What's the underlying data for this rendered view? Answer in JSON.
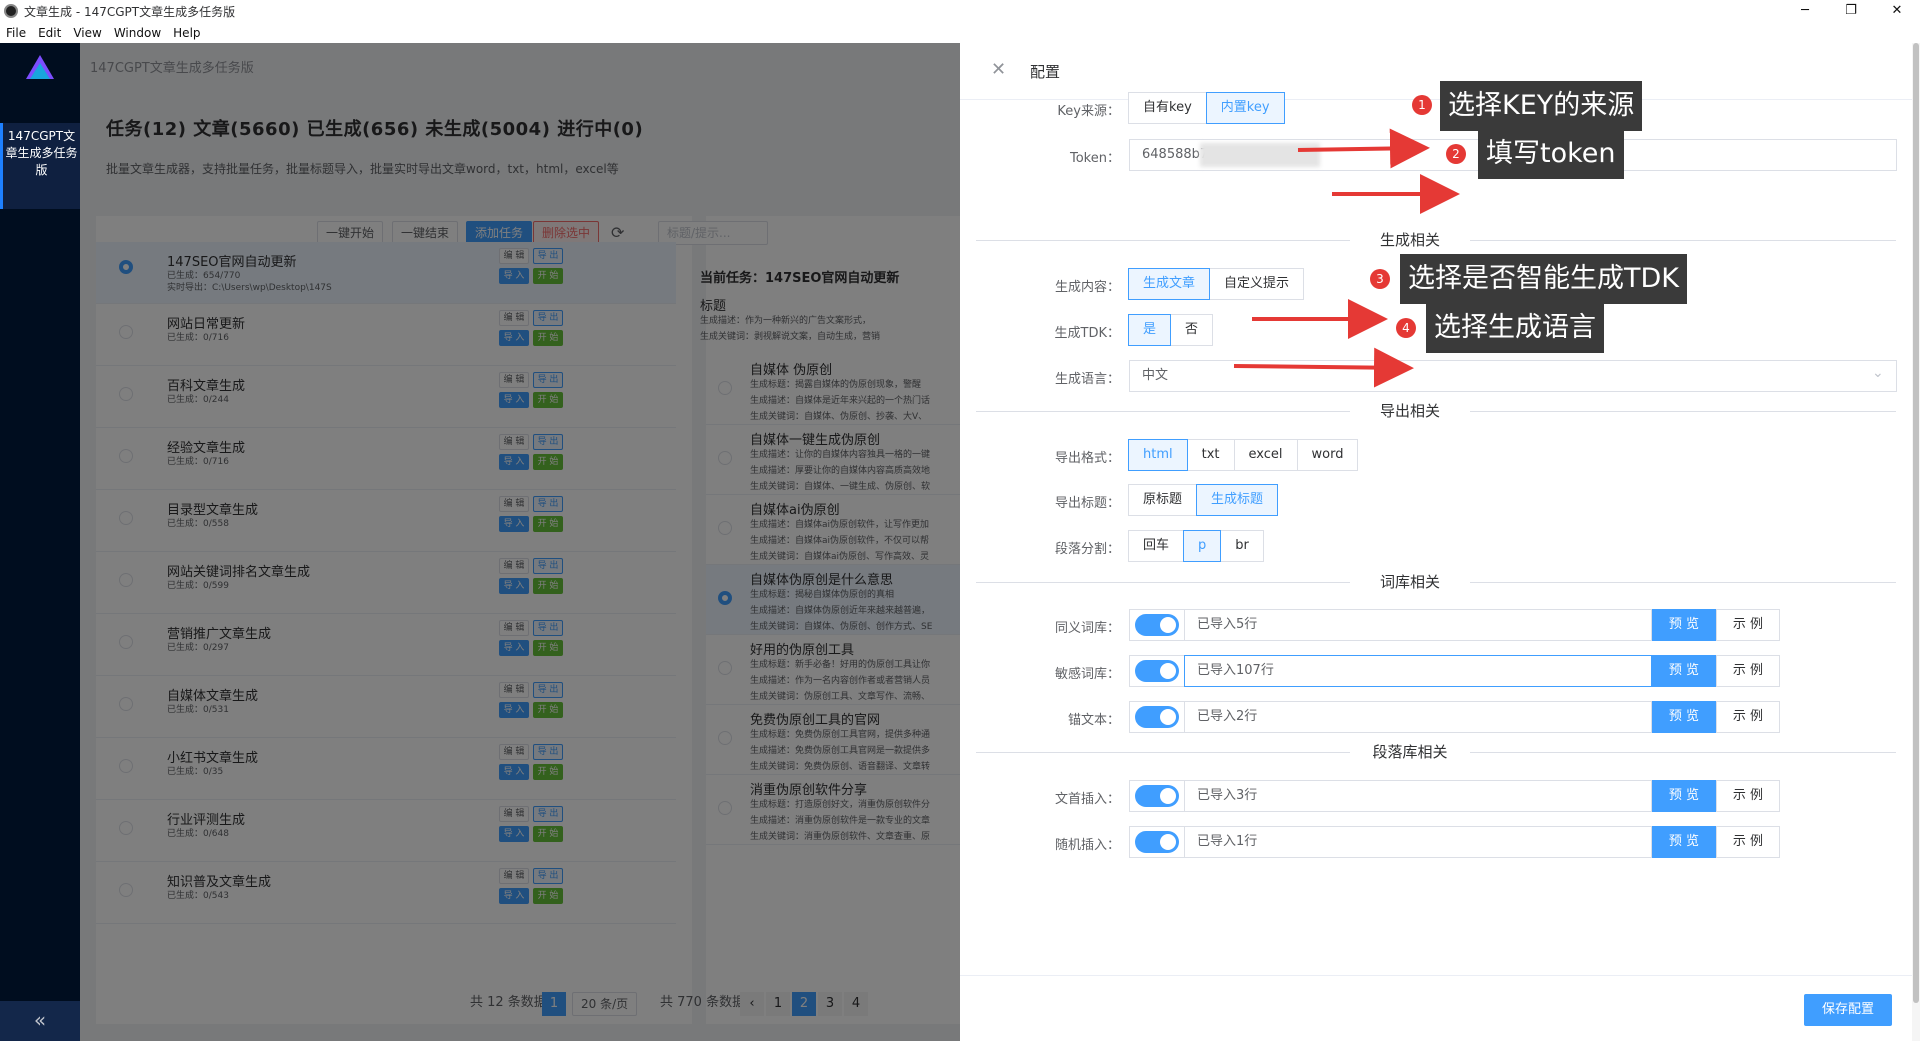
{
  "window": {
    "title": "文章生成 - 147CGPT文章生成多任务版",
    "controls": [
      "─",
      "❐",
      "✕"
    ]
  },
  "menu": [
    "File",
    "Edit",
    "View",
    "Window",
    "Help"
  ],
  "sidebar": {
    "item_label": "147CGPT文章生成多任务版",
    "collapse": "«"
  },
  "breadcrumb": "147CGPT文章生成多任务版",
  "header": {
    "title": "任务(12) 文章(5660) 已生成(656) 未生成(5004) 进行中(0)",
    "desc": "批量文章生成器，支持批量任务，批量标题导入，批量实时导出文章word，txt，html，excel等"
  },
  "toolbar": {
    "start_all": "一键开始",
    "end_all": "一键结束",
    "add_task": "添加任务",
    "delete_selected": "删除选中",
    "search_placeholder": "标题/提示..."
  },
  "task_table": {
    "col_task": "任务",
    "col_op": "操作",
    "btn_edit": "编 辑",
    "btn_export": "导 出",
    "btn_import": "导 入",
    "btn_start": "开 始",
    "rows": [
      {
        "name": "147SEO官网自动更新",
        "sub": "已生成：654/770",
        "extra": "实时导出：C:\\Users\\wp\\Desktop\\147S",
        "selected": true
      },
      {
        "name": "网站日常更新",
        "sub": "已生成：0/716",
        "selected": false
      },
      {
        "name": "百科文章生成",
        "sub": "已生成：0/244",
        "selected": false
      },
      {
        "name": "经验文章生成",
        "sub": "已生成：0/716",
        "selected": false
      },
      {
        "name": "目录型文章生成",
        "sub": "已生成：0/558",
        "selected": false
      },
      {
        "name": "网站关键词排名文章生成",
        "sub": "已生成：0/599",
        "selected": false
      },
      {
        "name": "营销推广文章生成",
        "sub": "已生成：0/297",
        "selected": false
      },
      {
        "name": "自媒体文章生成",
        "sub": "已生成：0/531",
        "selected": false
      },
      {
        "name": "小红书文章生成",
        "sub": "已生成：0/35",
        "selected": false
      },
      {
        "name": "行业评测生成",
        "sub": "已生成：0/648",
        "selected": false
      },
      {
        "name": "知识普及文章生成",
        "sub": "已生成：0/543",
        "selected": false
      }
    ],
    "pager_total": "共 12 条数据",
    "pager_page": "1",
    "pager_size": "20 条/页"
  },
  "article_panel": {
    "current": "当前任务：147SEO官网自动更新",
    "col_title": "标题",
    "rows": [
      {
        "title": "自媒体 伪原创",
        "l1": "生成标题：揭露自媒体的伪原创现象，警醒",
        "l2": "生成描述：自媒体是近年来兴起的一个热门话",
        "l3": "生成关键词：自媒体、伪原创、抄袭、大V、",
        "selected": false
      },
      {
        "title": "自媒体一键生成伪原创",
        "l1": "生成描述：让你的自媒体内容独具一格的一键",
        "l2": "生成描述：厚要让你的自媒体内容高质高效地",
        "l3": "生成关键词：自媒体、一键生成、伪原创、软",
        "selected": false
      },
      {
        "title": "自媒体ai伪原创",
        "l1": "生成描述：自媒体ai伪原创软件，让写作更加",
        "l2": "生成描述：自媒体ai伪原创软件，不仅可以帮",
        "l3": "生成关键词：自媒体ai伪原创、写作高效、灵",
        "selected": false
      },
      {
        "title": "自媒体伪原创是什么意思",
        "l1": "生成标题：揭秘自媒体伪原创的真相",
        "l2": "生成描述：自媒体伪原创近年来越来越普遍，",
        "l3": "生成关键词：自媒体、伪原创、创作方式、SE",
        "selected": true
      },
      {
        "title": "好用的伪原创工具",
        "l1": "生成标题：新手必备！好用的伪原创工具让你",
        "l2": "生成描述：作为一名内容创作者或者营销人员",
        "l3": "生成关键词：伪原创工具、文章写作、流畅、",
        "selected": false
      },
      {
        "title": "免费伪原创工具的官网",
        "l1": "生成标题：免费伪原创工具官网，提供多种通",
        "l2": "生成描述：免费伪原创工具官网是一款提供多",
        "l3": "生成关键词：免费伪原创、语音翻译、文章转",
        "selected": false
      },
      {
        "title": "消重伪原创软件分享",
        "l1": "生成标题：打造原创好文，消重伪原创软件分",
        "l2": "生成描述：消重伪原创软件是一款专业的文章",
        "l3": "生成关键词：消重伪原创软件、文章查重、原",
        "selected": false
      }
    ],
    "top_l1": "生成描述：作为一种新兴的广告文案形式，",
    "top_l2": "生成关键词：剥视解说文案，自动生成，营销",
    "pager_total": "共 770 条数据",
    "pages": [
      "‹",
      "1",
      "2",
      "3",
      "4"
    ],
    "current_page": "2"
  },
  "drawer": {
    "close": "✕",
    "title": "配置",
    "key_source": {
      "label": "Key来源：",
      "options": [
        "自有key",
        "内置key"
      ],
      "selected": "内置key"
    },
    "token": {
      "label": "Token：",
      "value": "648588b7"
    },
    "section_gen": "生成相关",
    "gen_content": {
      "label": "生成内容：",
      "options": [
        "生成文章",
        "自定义提示"
      ],
      "selected": "生成文章"
    },
    "gen_tdk": {
      "label": "生成TDK：",
      "options": [
        "是",
        "否"
      ],
      "selected": "是"
    },
    "gen_lang": {
      "label": "生成语言：",
      "value": "中文"
    },
    "section_export": "导出相关",
    "export_format": {
      "label": "导出格式：",
      "options": [
        "html",
        "txt",
        "excel",
        "word"
      ],
      "selected": "html"
    },
    "export_title": {
      "label": "导出标题：",
      "options": [
        "原标题",
        "生成标题"
      ],
      "selected": "生成标题"
    },
    "paragraph_split": {
      "label": "段落分割：",
      "options": [
        "回车",
        "p",
        "br"
      ],
      "selected": "p"
    },
    "section_lexicon": "词库相关",
    "preview": "预 览",
    "example": "示 例",
    "lexicon": [
      {
        "label": "同义词库：",
        "value": "已导入5行",
        "on": true
      },
      {
        "label": "敏感词库：",
        "value": "已导入107行",
        "on": true
      },
      {
        "label": "锚文本：",
        "value": "已导入2行",
        "on": true
      }
    ],
    "section_paragraph": "段落库相关",
    "paragraph": [
      {
        "label": "文首插入：",
        "value": "已导入3行",
        "on": true
      },
      {
        "label": "随机插入：",
        "value": "已导入1行",
        "on": true
      }
    ],
    "save": "保存配置"
  },
  "annotations": [
    {
      "num": "1",
      "text": "选择KEY的来源"
    },
    {
      "num": "2",
      "text": "填写token"
    },
    {
      "num": "3",
      "text": "选择是否智能生成TDK"
    },
    {
      "num": "4",
      "text": "选择生成语言"
    }
  ],
  "colors": {
    "primary": "#409eff",
    "success": "#67c23a",
    "danger": "#f56c6c",
    "sidebar": "#000d1f",
    "annotation_bg": "#3a3a3a",
    "arrow": "#e53935"
  }
}
